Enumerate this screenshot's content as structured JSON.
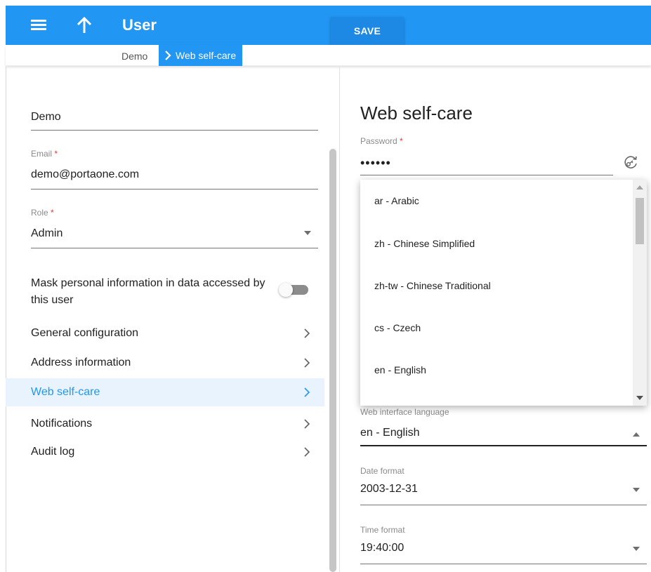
{
  "header": {
    "title": "User",
    "save_label": "SAVE"
  },
  "breadcrumb": {
    "parent": "Demo",
    "current": "Web self-care"
  },
  "left": {
    "name_value": "Demo",
    "email": {
      "label": "Email",
      "required": "*",
      "value": "demo@portaone.com"
    },
    "role": {
      "label": "Role",
      "required": "*",
      "value": "Admin"
    },
    "mask_label": "Mask personal information in data accessed by this user",
    "mask_enabled": false,
    "nav": [
      {
        "label": "General configuration"
      },
      {
        "label": "Address information"
      },
      {
        "label": "Web self-care",
        "active": true
      },
      {
        "label": "Notifications"
      },
      {
        "label": "Audit log"
      }
    ]
  },
  "right": {
    "title": "Web self-care",
    "password": {
      "label": "Password",
      "required": "*",
      "value": "••••••"
    },
    "language_options": [
      "ar - Arabic",
      "zh - Chinese Simplified",
      "zh-tw - Chinese Traditional",
      "cs - Czech",
      "en - English"
    ],
    "web_interface_language": {
      "label": "Web interface language",
      "value": "en - English"
    },
    "date_format": {
      "label": "Date format",
      "value": "2003-12-31"
    },
    "time_format": {
      "label": "Time format",
      "value": "19:40:00"
    }
  },
  "colors": {
    "primary": "#2196f3",
    "active_bg": "#e8f3fd",
    "required": "#e53935"
  },
  "icons": [
    "menu-icon",
    "arrow-up-icon",
    "chevron-right-icon",
    "regenerate-password-icon",
    "caret-down-icon",
    "caret-up-icon"
  ]
}
